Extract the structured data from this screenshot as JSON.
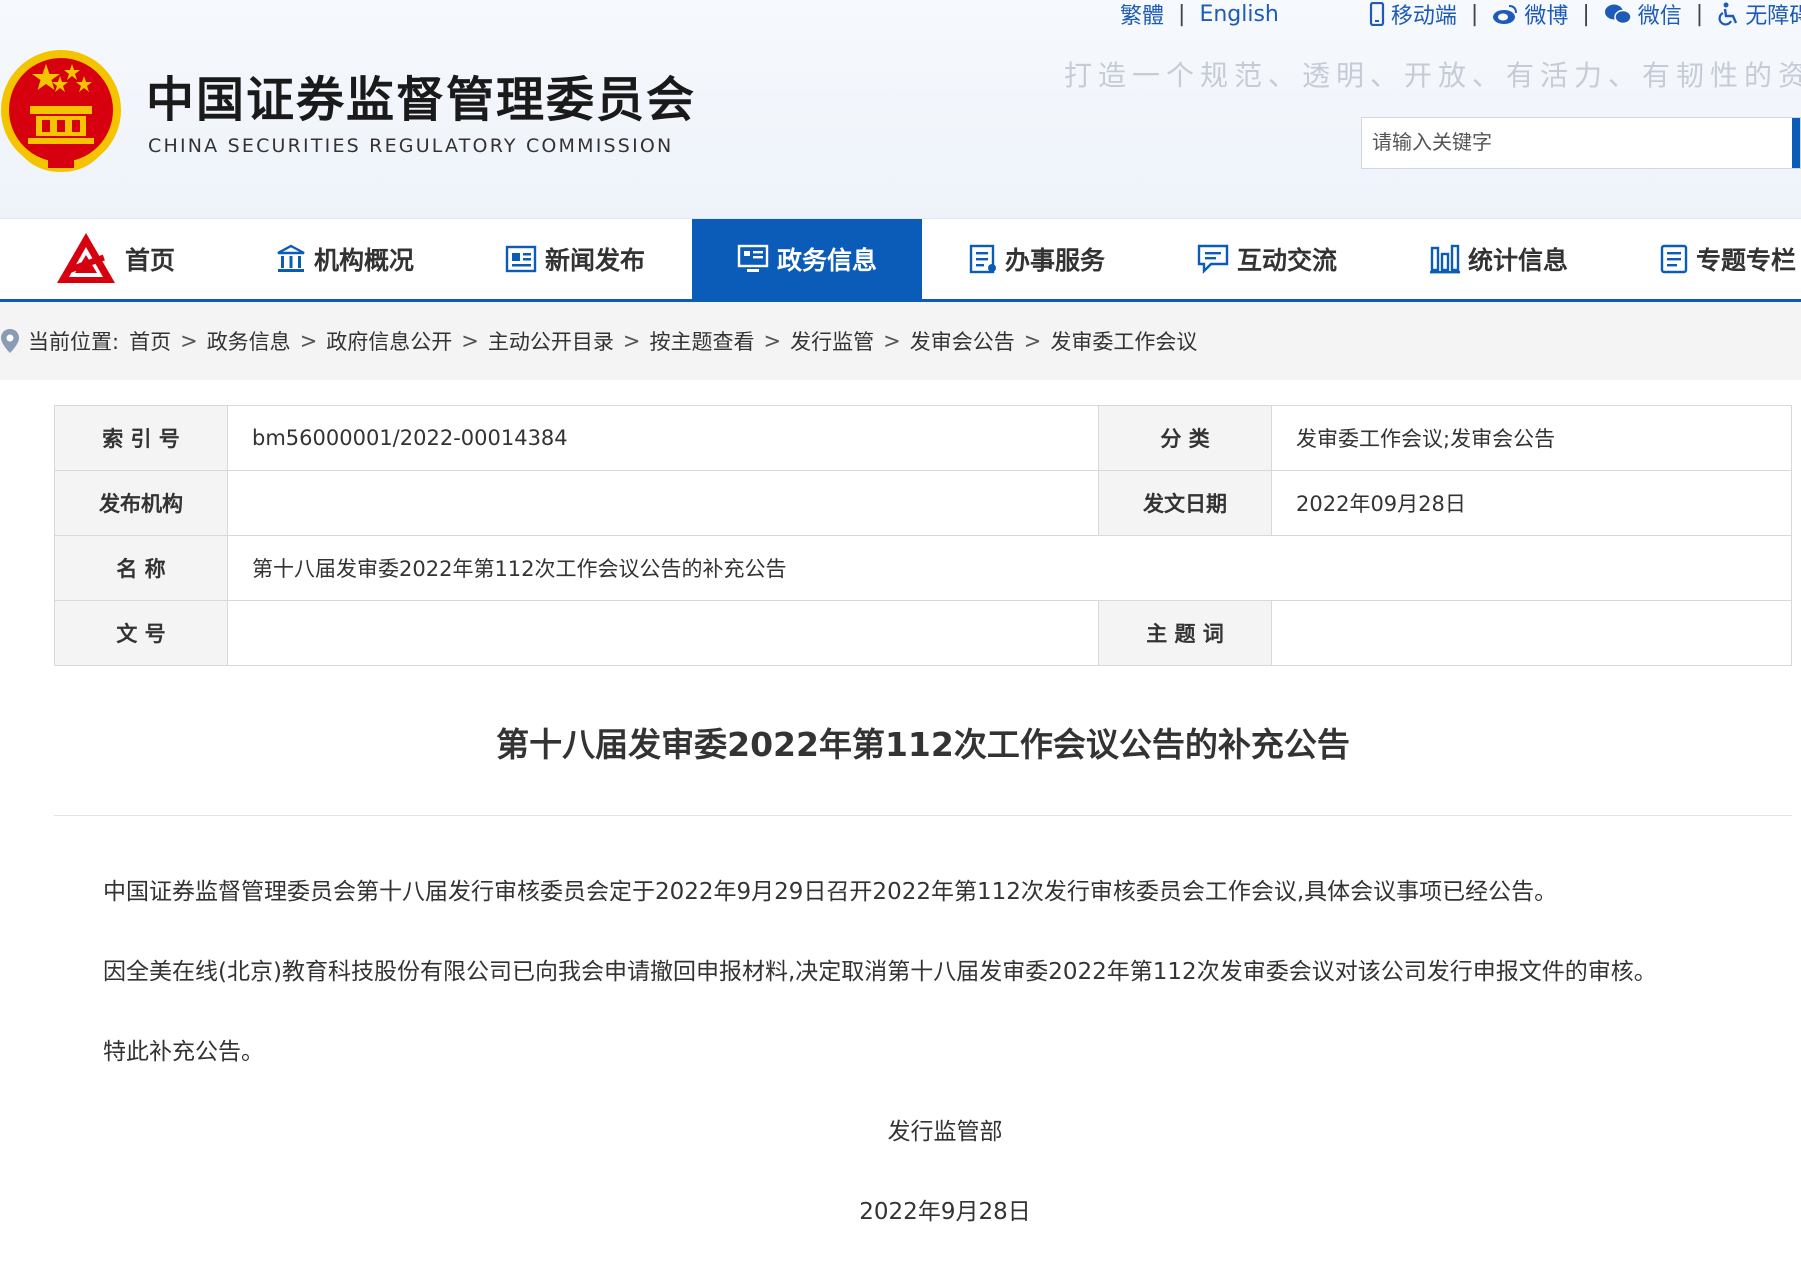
{
  "site": {
    "name_cn": "中国证券监督管理委员会",
    "name_en": "CHINA SECURITIES REGULATORY COMMISSION",
    "slogan": "打造一个规范、透明、开放、有活力、有韧性的资本市",
    "top_links": [
      "繁體",
      "English",
      "移动端",
      "微博",
      "微信",
      "无障碍"
    ],
    "search_placeholder": "请输入关键字"
  },
  "nav": {
    "items": [
      "首页",
      "机构概况",
      "新闻发布",
      "政务信息",
      "办事服务",
      "互动交流",
      "统计信息",
      "专题专栏"
    ],
    "active": "政务信息"
  },
  "breadcrumb": {
    "label": "当前位置:",
    "items": [
      "首页",
      "政务信息",
      "政府信息公开",
      "主动公开目录",
      "按主题查看",
      "发行监管",
      "发审会公告",
      "发审委工作会议"
    ]
  },
  "meta": {
    "index_label": "索 引 号",
    "index_value": "bm56000001/2022-00014384",
    "category_label": "分 类",
    "category_value": "发审委工作会议;发审会公告",
    "publisher_label": "发布机构",
    "publisher_value": "",
    "date_label": "发文日期",
    "date_value": "2022年09月28日",
    "name_label": "名 称",
    "name_value": "第十八届发审委2022年第112次工作会议公告的补充公告",
    "docno_label": "文 号",
    "docno_value": "",
    "subject_label": "主 题 词",
    "subject_value": ""
  },
  "article": {
    "title": "第十八届发审委2022年第112次工作会议公告的补充公告",
    "paragraphs": [
      "中国证券监督管理委员会第十八届发行审核委员会定于2022年9月29日召开2022年第112次发行审核委员会工作会议,具体会议事项已经公告。",
      "因全美在线(北京)教育科技股份有限公司已向我会申请撤回申报材料,决定取消第十八届发审委2022年第112次发审委会议对该公司发行申报文件的审核。",
      "特此补充公告。"
    ],
    "signature": "发行监管部",
    "date": "2022年9月28日"
  },
  "colors": {
    "primary": "#0b5bb8",
    "emblem_red": "#d7000f",
    "emblem_gold": "#f5c400"
  }
}
